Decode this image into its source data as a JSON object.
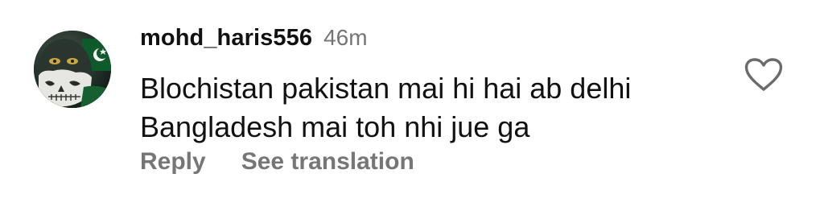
{
  "comment": {
    "username": "mohd_haris556",
    "time_ago": "46m",
    "text_lines": [
      "Blochistan pakistan mai hi hai ab delhi",
      "Bangladesh mai toh nhi jue ga"
    ],
    "actions": {
      "reply_label": "Reply",
      "translate_label": "See translation"
    },
    "avatar_icon": "masked-skull-avatar",
    "like_icon": "heart-outline-icon"
  },
  "colors": {
    "text": "#111111",
    "muted": "#767676",
    "background": "#ffffff"
  }
}
